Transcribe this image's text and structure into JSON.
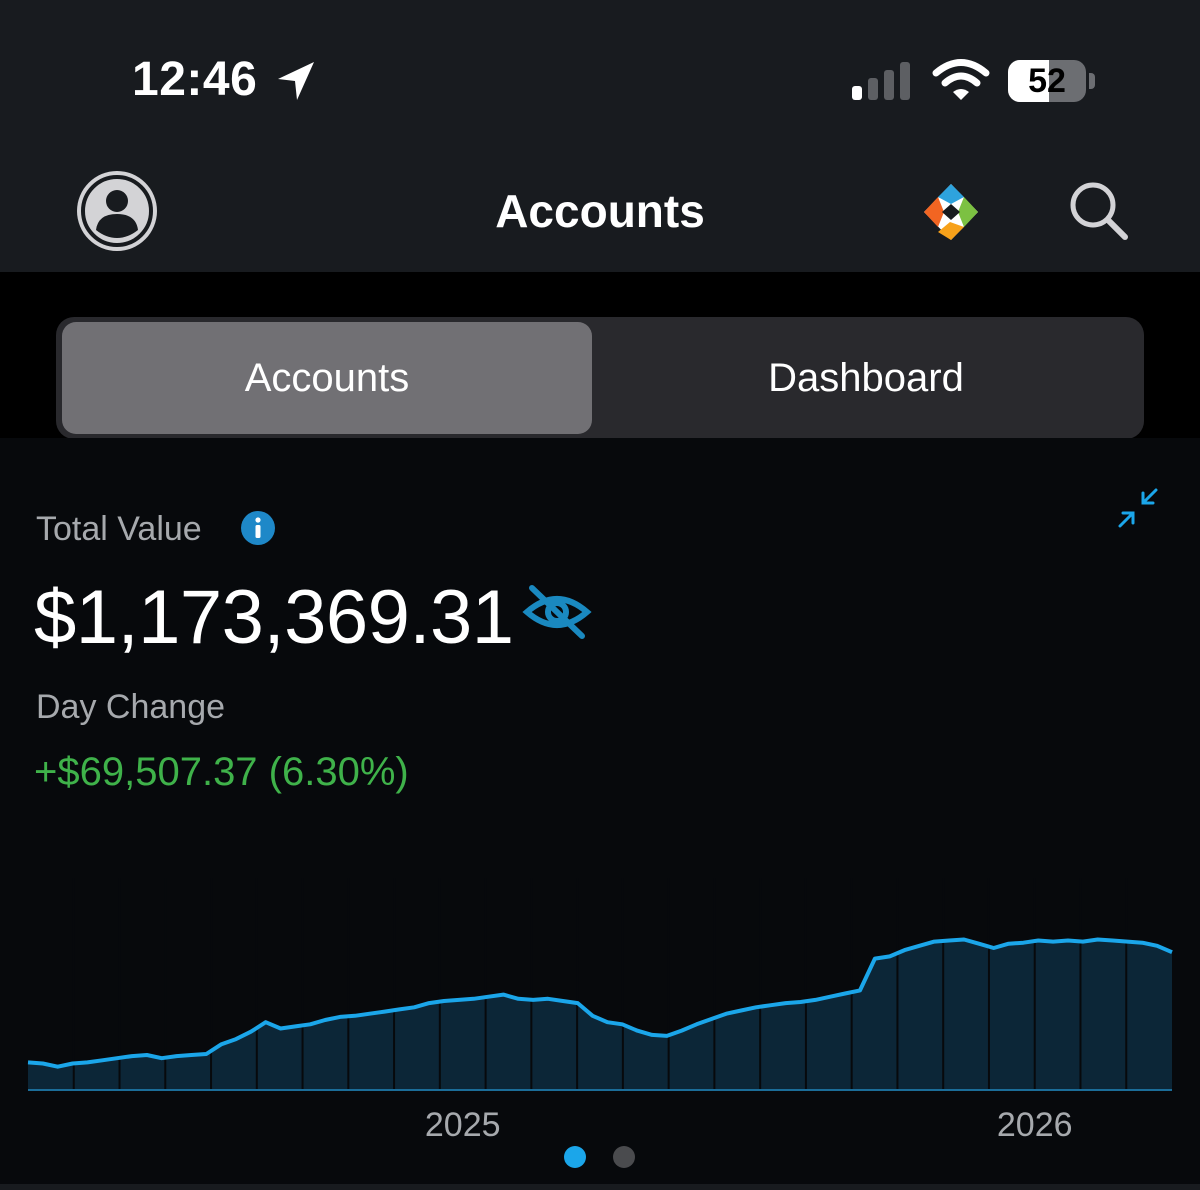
{
  "status_bar": {
    "time": "12:46",
    "battery": "52",
    "battery_level": 0.52
  },
  "header": {
    "title": "Accounts"
  },
  "tabs": [
    {
      "label": "Accounts",
      "active": true
    },
    {
      "label": "Dashboard",
      "active": false
    }
  ],
  "summary": {
    "total_label": "Total Value",
    "total_value": "$1,173,369.31",
    "day_change_label": "Day Change",
    "day_change_value": "+$69,507.37 (6.30%)"
  },
  "colors": {
    "accent": "#1ba6ea",
    "positive": "#3fb24a",
    "header_bg": "#181b1f",
    "panel_bg": "#07090c"
  },
  "icons": [
    "location-arrow-icon",
    "signal-icon",
    "wifi-icon",
    "battery-icon",
    "avatar-icon",
    "app-logo-icon",
    "search-icon",
    "info-icon",
    "collapse-icon",
    "eye-slash-icon"
  ],
  "pager": {
    "count": 2,
    "active_index": 0
  },
  "chart_data": {
    "type": "area",
    "title": "",
    "xlabel": "",
    "ylabel": "",
    "x_tick_labels": [
      "2025",
      "2026"
    ],
    "x_ticks": [
      0.38,
      0.88
    ],
    "y_axis_visible": false,
    "grid": false,
    "series": [
      {
        "values": [
          0.13,
          0.125,
          0.11,
          0.125,
          0.13,
          0.14,
          0.15,
          0.16,
          0.165,
          0.15,
          0.16,
          0.165,
          0.17,
          0.215,
          0.24,
          0.275,
          0.32,
          0.29,
          0.3,
          0.31,
          0.33,
          0.345,
          0.35,
          0.36,
          0.37,
          0.38,
          0.39,
          0.41,
          0.42,
          0.425,
          0.43,
          0.44,
          0.45,
          0.43,
          0.425,
          0.43,
          0.42,
          0.41,
          0.35,
          0.32,
          0.31,
          0.28,
          0.26,
          0.255,
          0.28,
          0.31,
          0.335,
          0.36,
          0.375,
          0.39,
          0.4,
          0.41,
          0.415,
          0.425,
          0.44,
          0.455,
          0.47,
          0.62,
          0.63,
          0.66,
          0.68,
          0.7,
          0.705,
          0.71,
          0.69,
          0.67,
          0.69,
          0.695,
          0.705,
          0.7,
          0.705,
          0.7,
          0.71,
          0.705,
          0.7,
          0.695,
          0.68,
          0.65
        ]
      }
    ]
  }
}
